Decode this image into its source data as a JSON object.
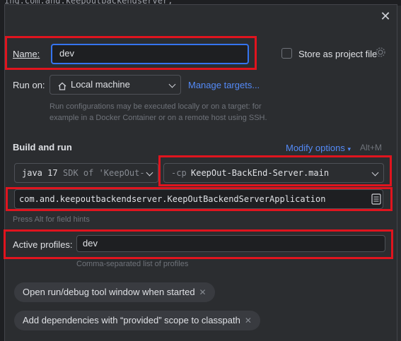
{
  "background": {
    "code_line": "ing.com.and.keepoutbackendserver;"
  },
  "dialog": {
    "close_label": "✕",
    "name": {
      "label": "Name:",
      "value": "dev"
    },
    "store_project": {
      "label": "Store as project file",
      "checked": false,
      "icon": "gear-icon"
    },
    "run_on": {
      "label": "Run on:",
      "value": "Local machine",
      "icon": "home-icon",
      "manage_label": "Manage targets...",
      "hint_line1": "Run configurations may be executed locally or on a target: for",
      "hint_line2": "example in a Docker Container or on a remote host using SSH."
    },
    "build_and_run": {
      "title": "Build and run",
      "modify_label": "Modify options",
      "modify_shortcut": "Alt+M",
      "jdk": {
        "version": "java 17",
        "detail": "SDK of 'KeepOut-"
      },
      "classpath": {
        "prefix": "-cp",
        "module": "KeepOut-BackEnd-Server.main"
      },
      "main_class": "com.and.keepoutbackendserver.KeepOutBackendServerApplication",
      "field_hint": "Press Alt for field hints"
    },
    "active_profiles": {
      "label": "Active profiles:",
      "value": "dev",
      "hint": "Comma-separated list of profiles"
    },
    "chips": [
      {
        "label": "Open run/debug tool window when started",
        "remove": "✕"
      },
      {
        "label": "Add dependencies with “provided” scope to classpath",
        "remove": "✕"
      }
    ]
  },
  "colors": {
    "accent": "#3574f0",
    "link": "#548af7",
    "annotation": "#e0141e"
  }
}
